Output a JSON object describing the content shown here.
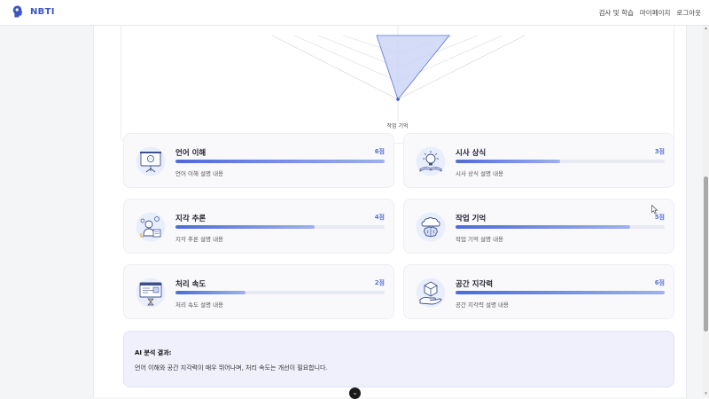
{
  "header": {
    "logo_text": "NBTI",
    "nav": [
      "검사 및 학습",
      "마이페이지",
      "로그아웃"
    ]
  },
  "radar": {
    "bottom_label": "작업 기억"
  },
  "cards": [
    {
      "title": "언어 이해",
      "score": "6점",
      "level": 1.0,
      "desc": "언어 이해 설명 내용",
      "icon": "presentation-board-icon"
    },
    {
      "title": "시사 상식",
      "score": "3점",
      "level": 0.5,
      "desc": "시사 상식 설명 내용",
      "icon": "open-book-lightbulb-icon"
    },
    {
      "title": "지각 추론",
      "score": "4점",
      "level": 0.667,
      "desc": "지각 추론 설명 내용",
      "icon": "reasoning-thinker-icon"
    },
    {
      "title": "작업 기억",
      "score": "5점",
      "level": 0.833,
      "desc": "작업 기억 설명 내용",
      "icon": "cloud-brain-icon"
    },
    {
      "title": "처리 속도",
      "score": "2점",
      "level": 0.333,
      "desc": "처리 속도 설명 내용",
      "icon": "computer-hourglass-icon"
    },
    {
      "title": "공간 지각력",
      "score": "6점",
      "level": 1.0,
      "desc": "공간 지각력 설명 내용",
      "icon": "hand-cube-icon"
    }
  ],
  "ai": {
    "title": "AI 분석 결과:",
    "text": "언어 이해와 공간 지각력이 매우 뛰어나며, 처리 속도는 개선이 필요합니다."
  },
  "colors": {
    "accent": "#4d6bd9",
    "accent_light": "#9fb0ef",
    "ai_box_bg": "#f0f0fd"
  }
}
